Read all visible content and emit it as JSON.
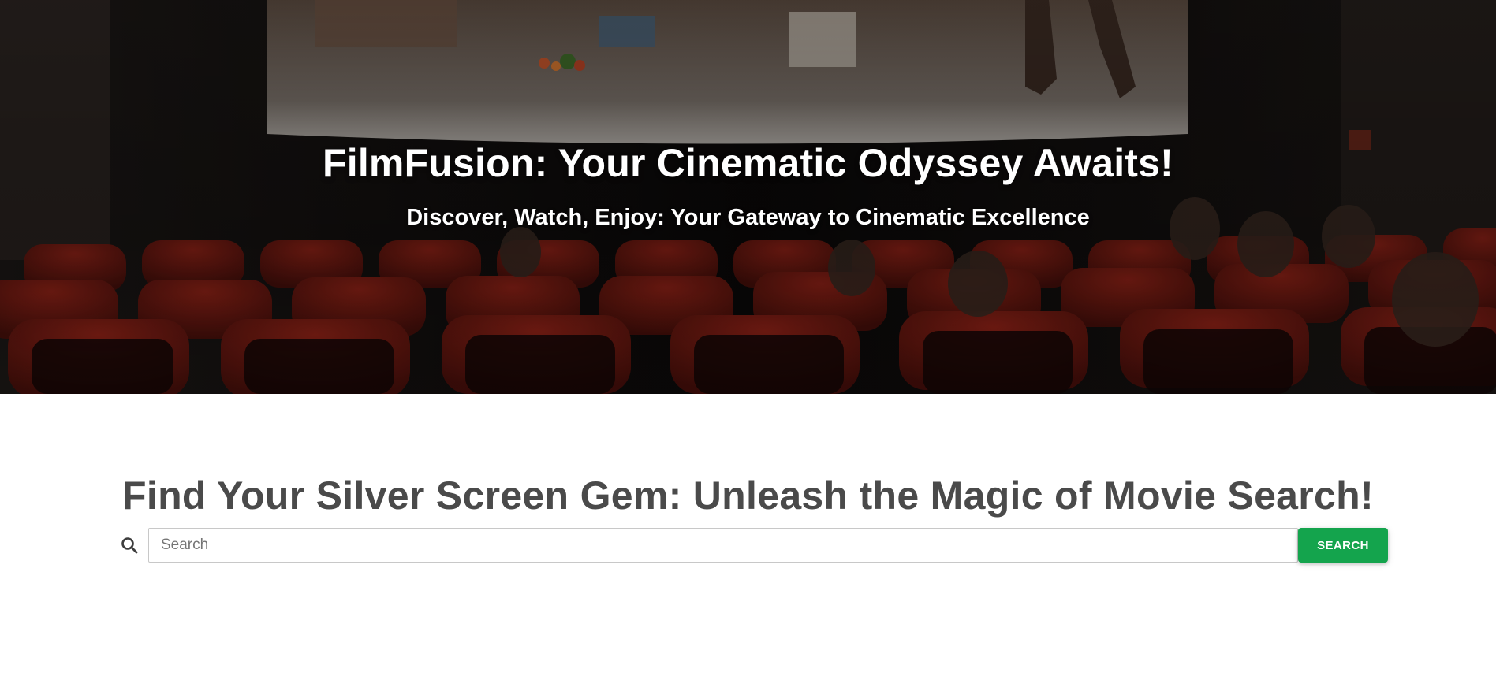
{
  "hero": {
    "title": "FilmFusion: Your Cinematic Odyssey Awaits!",
    "subtitle": "Discover, Watch, Enjoy: Your Gateway to Cinematic Excellence"
  },
  "search": {
    "heading": "Find Your Silver Screen Gem: Unleash the Magic of Movie Search!",
    "placeholder": "Search",
    "button_label": "SEARCH",
    "icon": "search-icon"
  },
  "colors": {
    "button": "#14a44d",
    "heading": "#4a4a4a",
    "seat_red": "#8a1c14"
  }
}
